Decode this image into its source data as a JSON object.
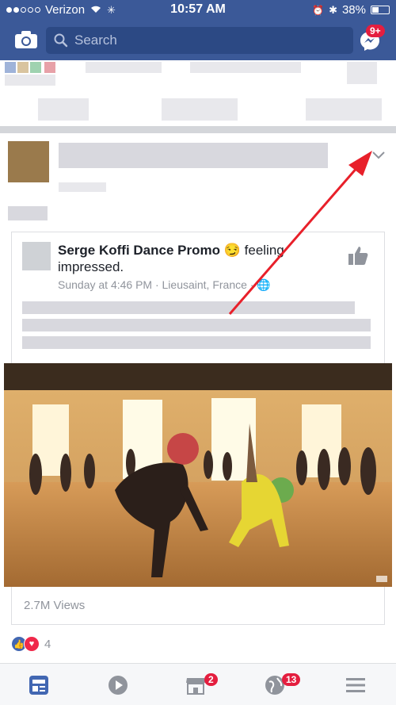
{
  "status_bar": {
    "carrier": "Verizon",
    "time": "10:57 AM",
    "battery": "38%"
  },
  "nav": {
    "search_placeholder": "Search",
    "messenger_badge": "9+"
  },
  "post": {
    "shared": {
      "page_name": "Serge Koffi Dance Promo",
      "feeling": "feeling",
      "feeling_value": "impressed.",
      "meta": "Sunday at 4:46 PM · Lieusaint, France ·"
    },
    "views": "2.7M Views",
    "reaction_count": "4"
  },
  "tabbar": {
    "marketplace_badge": "2",
    "notifications_badge": "13"
  },
  "colors": {
    "brand": "#3b5998",
    "badge": "#e41e3f",
    "arrow": "#e8202a",
    "like": "#4267b2",
    "love": "#f0284a"
  }
}
